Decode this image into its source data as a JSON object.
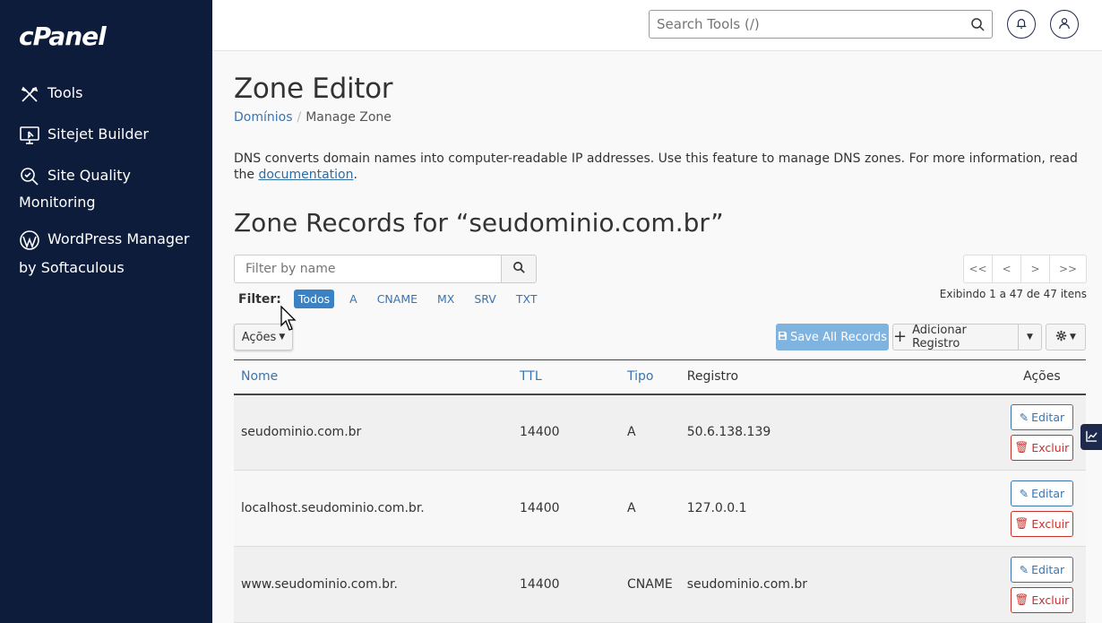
{
  "sidebar": {
    "logo": "cPanel",
    "items": [
      {
        "label": "Tools",
        "icon": "tools-icon"
      },
      {
        "label": "Sitejet Builder",
        "icon": "sitejet-icon"
      },
      {
        "label": "Site Quality Monitoring",
        "icon": "site-quality-icon"
      },
      {
        "label": "WordPress Manager by Softaculous",
        "icon": "wordpress-icon"
      }
    ]
  },
  "header": {
    "search_placeholder": "Search Tools (/)"
  },
  "page": {
    "title": "Zone Editor",
    "breadcrumb": {
      "parent": "Domínios",
      "current": "Manage Zone"
    },
    "description": "DNS converts domain names into computer-readable IP addresses. Use this feature to manage DNS zones. For more information, read the ",
    "description_link": "documentation",
    "description_end": ".",
    "zone_title": "Zone Records for “seudominio.com.br”"
  },
  "filter": {
    "placeholder": "Filter by name",
    "label": "Filter:",
    "chips": [
      "Todos",
      "A",
      "CNAME",
      "MX",
      "SRV",
      "TXT"
    ],
    "active": "Todos"
  },
  "pager": {
    "first": "<<",
    "prev": "<",
    "next": ">",
    "last": ">>",
    "showing": "Exibindo 1 a 47 de 47 itens"
  },
  "toolbar": {
    "actions": "Ações",
    "save_all": "Save All Records",
    "add_record": "Adicionar Registro"
  },
  "table": {
    "headers": {
      "name": "Nome",
      "ttl": "TTL",
      "type": "Tipo",
      "record": "Registro",
      "actions": "Ações"
    },
    "rows": [
      {
        "name": "seudominio.com.br",
        "ttl": "14400",
        "type": "A",
        "record": "50.6.138.139"
      },
      {
        "name": "localhost.seudominio.com.br.",
        "ttl": "14400",
        "type": "A",
        "record": "127.0.0.1"
      },
      {
        "name": "www.seudominio.com.br.",
        "ttl": "14400",
        "type": "CNAME",
        "record": "seudominio.com.br"
      }
    ],
    "edit_label": "Editar",
    "delete_label": "Excluir"
  },
  "colors": {
    "sidebar_bg": "#0e1c3c",
    "link": "#3a74b0",
    "danger": "#c9302c",
    "active_chip": "#3a82c4"
  }
}
